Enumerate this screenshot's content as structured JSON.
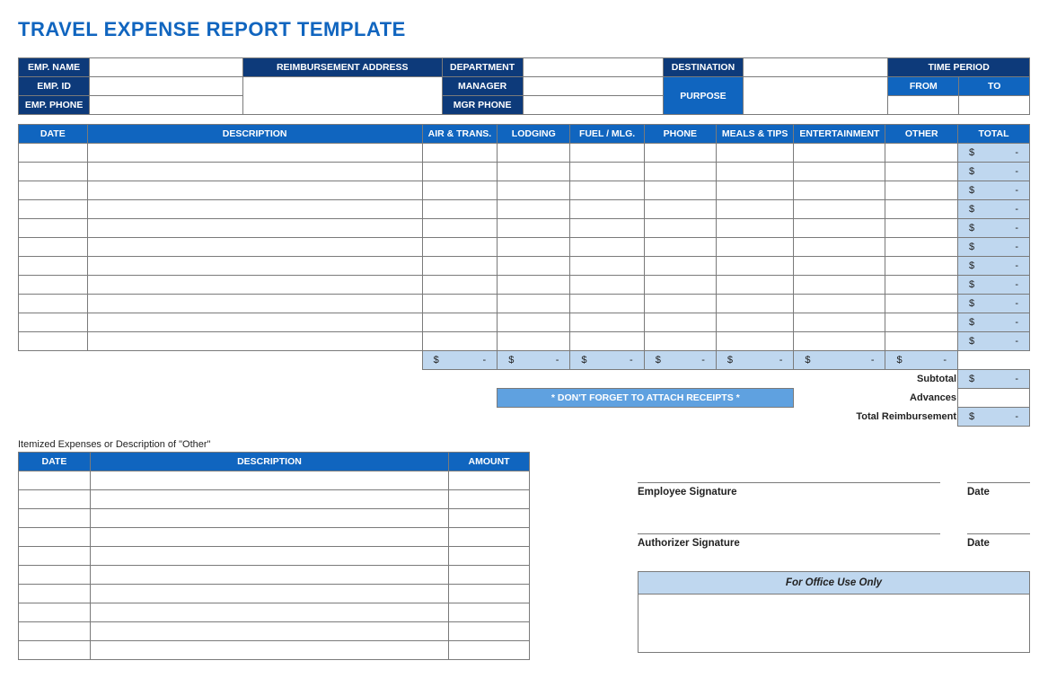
{
  "title": "TRAVEL EXPENSE REPORT TEMPLATE",
  "top": {
    "empName": "EMP. NAME",
    "empId": "EMP. ID",
    "empPhone": "EMP. PHONE",
    "reimbAddr": "REIMBURSEMENT ADDRESS",
    "department": "DEPARTMENT",
    "manager": "MANAGER",
    "mgrPhone": "MGR PHONE",
    "destination": "DESTINATION",
    "purpose": "PURPOSE",
    "timePeriod": "TIME PERIOD",
    "from": "FROM",
    "to": "TO"
  },
  "grid": {
    "headers": {
      "date": "DATE",
      "description": "DESCRIPTION",
      "air": "AIR & TRANS.",
      "lodging": "LODGING",
      "fuel": "FUEL / MLG.",
      "phone": "PHONE",
      "meals": "MEALS & TIPS",
      "ent": "ENTERTAINMENT",
      "other": "OTHER",
      "total": "TOTAL"
    },
    "totals": {
      "sym": "$",
      "dash": "-"
    }
  },
  "labels": {
    "subtotal": "Subtotal",
    "advances": "Advances",
    "totalReimb": "Total Reimbursement",
    "receipts": "*  DON'T FORGET TO ATTACH RECEIPTS  *",
    "itemized": "Itemized Expenses or Description of \"Other\"",
    "empSig": "Employee Signature",
    "authSig": "Authorizer Signature",
    "date": "Date",
    "office": "For Office Use Only"
  },
  "itemized": {
    "date": "DATE",
    "description": "DESCRIPTION",
    "amount": "AMOUNT"
  }
}
